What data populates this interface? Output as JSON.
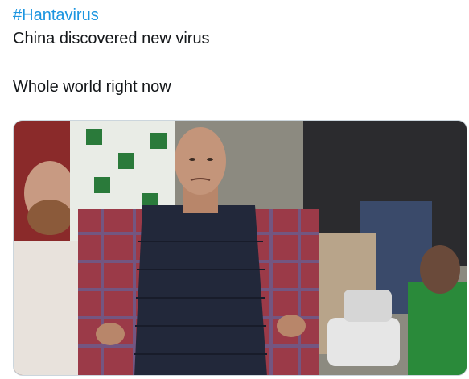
{
  "tweet": {
    "hashtag": "#Hantavirus",
    "line1": "China discovered new virus",
    "line2": "Whole world right now"
  },
  "colors": {
    "hashtag": "#1b95e0",
    "text": "#14171a",
    "media_border": "#ccd6dd"
  },
  "media": {
    "description_icon": "photo-meme-disappointed-fan"
  }
}
